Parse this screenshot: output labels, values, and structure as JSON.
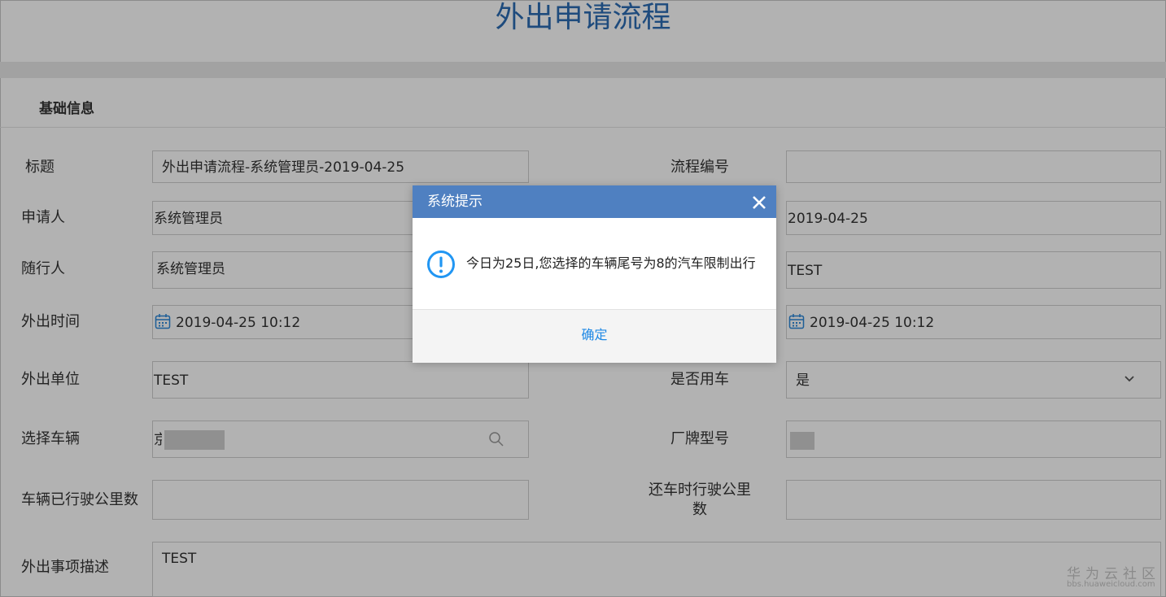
{
  "page": {
    "title": "外出申请流程"
  },
  "section": {
    "title": "基础信息"
  },
  "form": {
    "title_label": "标题",
    "title_value": "外出申请流程-系统管理员-2019-04-25",
    "process_no_label": "流程编号",
    "process_no_value": "",
    "applicant_label": "申请人",
    "applicant_value": "系统管理员",
    "apply_date_value": "2019-04-25",
    "companion_label": "随行人",
    "companion_value": "系统管理员",
    "right3_value": "TEST",
    "out_time_label": "外出时间",
    "out_time_value": "2019-04-25 10:12",
    "return_time_value": "2019-04-25 10:12",
    "out_unit_label": "外出单位",
    "out_unit_value": "TEST",
    "use_car_label": "是否用车",
    "use_car_value": "是",
    "vehicle_label": "选择车辆",
    "vehicle_value": "京",
    "model_label": "厂牌型号",
    "mileage_label": "车辆已行驶公里数",
    "return_mileage_label_1": "还车时行驶公里",
    "return_mileage_label_2": "数",
    "desc_label": "外出事项描述",
    "desc_value": "TEST"
  },
  "dialog": {
    "title": "系统提示",
    "message": "今日为25日,您选择的车辆尾号为8的汽车限制出行",
    "ok_label": "确定"
  },
  "watermark": {
    "line1": "华为云社区",
    "line2": "bbs.huaweicloud.com"
  },
  "colors": {
    "title": "#2b6cb3",
    "dialog_header": "#4f80c1",
    "ok_link": "#1e88e5",
    "warning_icon": "#2196f3"
  }
}
